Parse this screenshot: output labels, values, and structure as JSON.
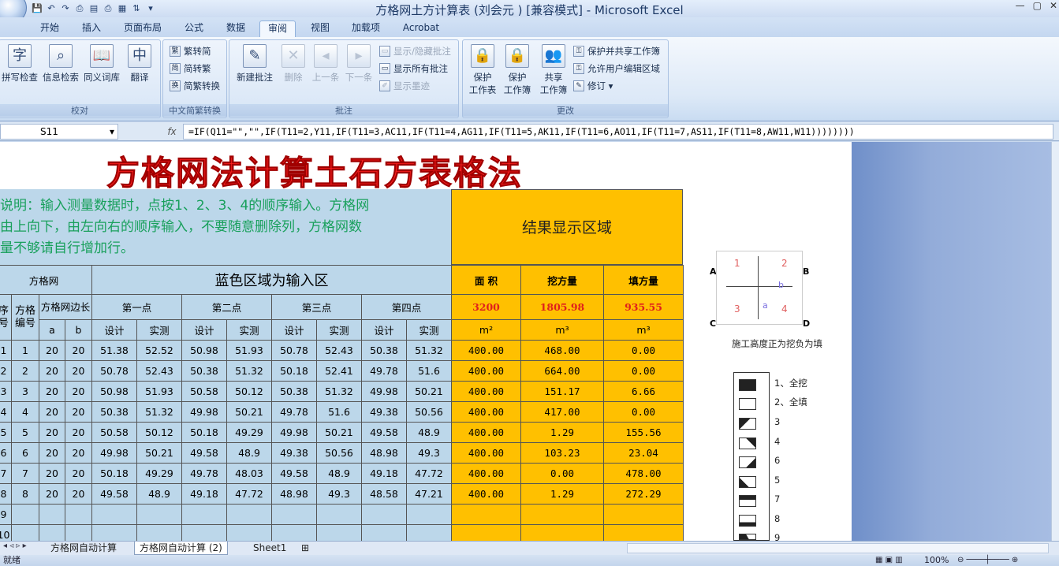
{
  "window": {
    "title": "方格网土方计算表 (刘会元 )  [兼容模式] - Microsoft Excel",
    "controls": [
      "—",
      "▢",
      "✕"
    ]
  },
  "tabs": [
    "开始",
    "插入",
    "页面布局",
    "公式",
    "数据",
    "审阅",
    "视图",
    "加载项",
    "Acrobat"
  ],
  "active_tab": "审阅",
  "ribbon": {
    "groups": {
      "proofing": "校对",
      "chinese": "中文简繁转换",
      "comments": "批注",
      "changes": "更改"
    },
    "proofing": [
      "拼写检查",
      "信息检索",
      "同义词库",
      "翻译"
    ],
    "chinese": [
      "繁转简",
      "简转繁",
      "简繁转换"
    ],
    "comments_big": [
      "新建批注",
      "删除",
      "上一条",
      "下一条"
    ],
    "comments_small": [
      "显示/隐藏批注",
      "显示所有批注",
      "显示墨迹"
    ],
    "changes_big": [
      [
        "保护",
        "工作表"
      ],
      [
        "保护",
        "工作簿"
      ],
      [
        "共享",
        "工作簿"
      ]
    ],
    "changes_small": [
      "保护并共享工作簿",
      "允许用户编辑区域",
      "修订"
    ]
  },
  "formula_bar": {
    "cell": "S11",
    "fx": "fx",
    "formula": "=IF(Q11=\"\",\"\",IF(T11=2,Y11,IF(T11=3,AC11,IF(T11=4,AG11,IF(T11=5,AK11,IF(T11=6,AO11,IF(T11=7,AS11,IF(T11=8,AW11,W11))))))))"
  },
  "sheet": {
    "title": "方格网法计算土石方表格法",
    "description": [
      "说明：输入测量数据时，点按1、2、3、4的顺序输入。方格网",
      "由上向下，由左向右的顺序输入，不要随意删除列，方格网数",
      "量不够请自行增加行。"
    ],
    "result_area": "结果显示区域",
    "headers": {
      "grid": "方格网",
      "input_area": "蓝色区域为输入区",
      "area": "面 积",
      "cut": "挖方量",
      "fill": "填方量",
      "seq": "序号",
      "grid_no": "方格编号",
      "side": "方格网边长",
      "a": "a",
      "b": "b",
      "points": [
        "第一点",
        "第二点",
        "第三点",
        "第四点"
      ],
      "design": "设计",
      "actual": "实测",
      "unit_area": "m²",
      "unit_vol": "m³"
    },
    "totals": {
      "area": "3200",
      "cut": "1805.98",
      "fill": "935.55"
    },
    "rows": [
      [
        "1",
        "1",
        "20",
        "20",
        "51.38",
        "52.52",
        "50.98",
        "51.93",
        "50.78",
        "52.43",
        "50.38",
        "51.32",
        "400.00",
        "468.00",
        "0.00"
      ],
      [
        "2",
        "2",
        "20",
        "20",
        "50.78",
        "52.43",
        "50.38",
        "51.32",
        "50.18",
        "52.41",
        "49.78",
        "51.6",
        "400.00",
        "664.00",
        "0.00"
      ],
      [
        "3",
        "3",
        "20",
        "20",
        "50.98",
        "51.93",
        "50.58",
        "50.12",
        "50.38",
        "51.32",
        "49.98",
        "50.21",
        "400.00",
        "151.17",
        "6.66"
      ],
      [
        "4",
        "4",
        "20",
        "20",
        "50.38",
        "51.32",
        "49.98",
        "50.21",
        "49.78",
        "51.6",
        "49.38",
        "50.56",
        "400.00",
        "417.00",
        "0.00"
      ],
      [
        "5",
        "5",
        "20",
        "20",
        "50.58",
        "50.12",
        "50.18",
        "49.29",
        "49.98",
        "50.21",
        "49.58",
        "48.9",
        "400.00",
        "1.29",
        "155.56"
      ],
      [
        "6",
        "6",
        "20",
        "20",
        "49.98",
        "50.21",
        "49.58",
        "48.9",
        "49.38",
        "50.56",
        "48.98",
        "49.3",
        "400.00",
        "103.23",
        "23.04"
      ],
      [
        "7",
        "7",
        "20",
        "20",
        "50.18",
        "49.29",
        "49.78",
        "48.03",
        "49.58",
        "48.9",
        "49.18",
        "47.72",
        "400.00",
        "0.00",
        "478.00"
      ],
      [
        "8",
        "8",
        "20",
        "20",
        "49.58",
        "48.9",
        "49.18",
        "47.72",
        "48.98",
        "49.3",
        "48.58",
        "47.21",
        "400.00",
        "1.29",
        "272.29"
      ],
      [
        "9",
        "",
        "",
        "",
        "",
        "",
        "",
        "",
        "",
        "",
        "",
        "",
        "",
        "",
        ""
      ],
      [
        "10",
        "",
        "",
        "",
        "",
        "",
        "",
        "",
        "",
        "",
        "",
        "",
        "",
        "",
        ""
      ]
    ],
    "diagram": {
      "corners": [
        "A",
        "B",
        "C",
        "D"
      ],
      "cells": [
        "1",
        "2",
        "3",
        "4"
      ],
      "a": "a",
      "b": "b"
    },
    "note": "施工高度正为挖负为填",
    "key": [
      "1、全挖",
      "2、全填",
      "3",
      "4",
      "6",
      "5",
      "7",
      "8",
      "9"
    ]
  },
  "sheet_tabs": [
    "方格网自动计算",
    "方格网自动计算 (2)",
    "Sheet1"
  ],
  "active_sheet": "方格网自动计算 (2)",
  "status": {
    "left": "就绪",
    "zoom": "100%"
  }
}
